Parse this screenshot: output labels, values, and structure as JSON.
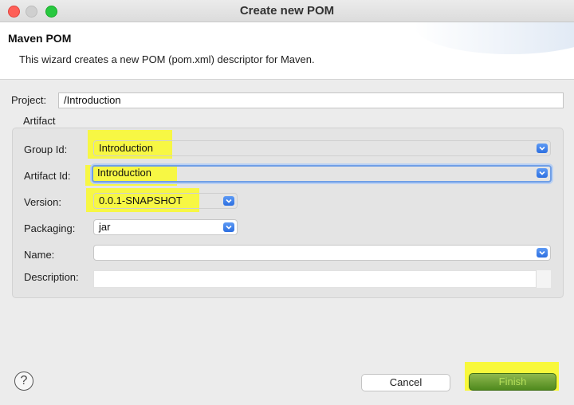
{
  "window": {
    "title": "Create new POM"
  },
  "header": {
    "title": "Maven POM",
    "description": "This wizard creates a new POM (pom.xml) descriptor for Maven."
  },
  "project": {
    "label": "Project:",
    "value": "/Introduction"
  },
  "artifact": {
    "group_label": "Artifact",
    "group_id": {
      "label": "Group Id:",
      "value": "Introduction"
    },
    "artifact_id": {
      "label": "Artifact Id:",
      "value": "Introduction"
    },
    "version": {
      "label": "Version:",
      "value": "0.0.1-SNAPSHOT"
    },
    "packaging": {
      "label": "Packaging:",
      "value": "jar"
    },
    "name": {
      "label": "Name:",
      "value": ""
    },
    "description": {
      "label": "Description:",
      "value": ""
    }
  },
  "buttons": {
    "help": "?",
    "cancel": "Cancel",
    "finish": "Finish"
  },
  "colors": {
    "highlight": "#f5f528",
    "finish": "#4f8a1e",
    "accent": "#2d6fe0"
  }
}
